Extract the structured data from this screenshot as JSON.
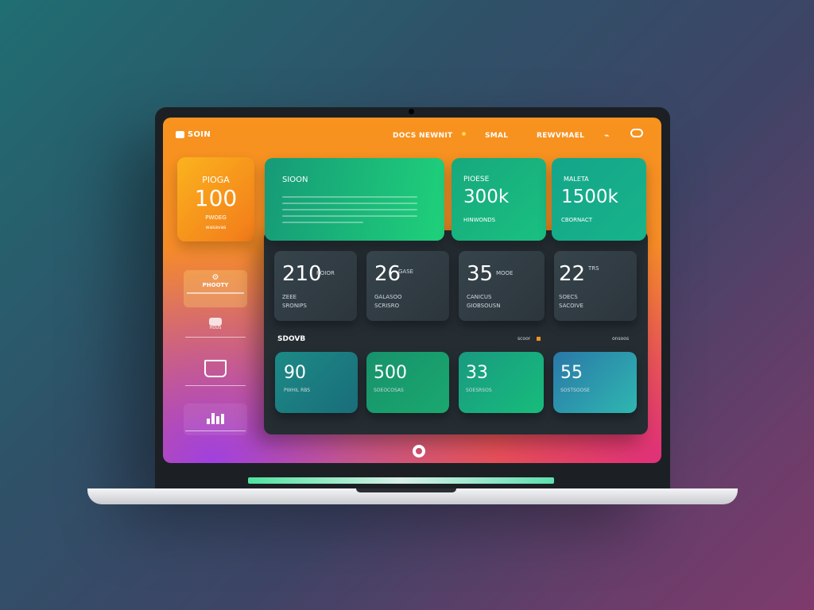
{
  "header": {
    "logo": "SOIN",
    "nav": [
      "DOCS",
      "NEWNIT",
      "SMAL",
      "REWVMAEL"
    ]
  },
  "top_cards": [
    {
      "label": "PIOGA",
      "value": "100",
      "sub": "PWOEG",
      "sub2": "wasavas",
      "color": "#f79a1a"
    },
    {
      "label": "SIOON",
      "color": "#1fb37a"
    },
    {
      "label": "PIOESE",
      "value": "300k",
      "sub": "HINWONDS",
      "color": "#17a87d"
    },
    {
      "label": "MALETA",
      "value": "1500k",
      "sub": "CBORNACT",
      "color": "#14a58a"
    }
  ],
  "stats": [
    {
      "value": "210",
      "unit": "ROIOR",
      "l1": "ZEEE",
      "l2": "SRONIPS"
    },
    {
      "value": "26",
      "unit": "GASE",
      "l1": "GALASOO",
      "l2": "SCRISRO"
    },
    {
      "value": "35",
      "unit": "MOOE",
      "l1": "CANICUS",
      "l2": "GIOBSOUSN"
    },
    {
      "value": "22",
      "unit": "TRS",
      "l1": "SOECS",
      "l2": "SACOIVE"
    }
  ],
  "section": {
    "title": "SDOVB",
    "link1": "scoor",
    "link2": "onsoos"
  },
  "bottom_cards": [
    {
      "value": "90",
      "sub": "PWHIL RBS",
      "color": "#1b7f83"
    },
    {
      "value": "500",
      "sub": "SOEOCOSAS",
      "color": "#16936c"
    },
    {
      "value": "33",
      "sub": "SOESRSOS",
      "color": "#17a87a"
    },
    {
      "value": "55",
      "sub": "SOSTSOOSE",
      "color": "#2e86b0"
    }
  ],
  "sidebar": [
    {
      "label": "PHOOTY",
      "icon": "gear-icon"
    },
    {
      "label": "HOUS",
      "icon": "chart-icon"
    },
    {
      "label": "",
      "icon": "monitor-icon"
    },
    {
      "label": "",
      "icon": "bar-chart-icon"
    }
  ],
  "colors": {
    "accent": "#f7931e",
    "green": "#1fb37a",
    "dark": "#252d33"
  }
}
